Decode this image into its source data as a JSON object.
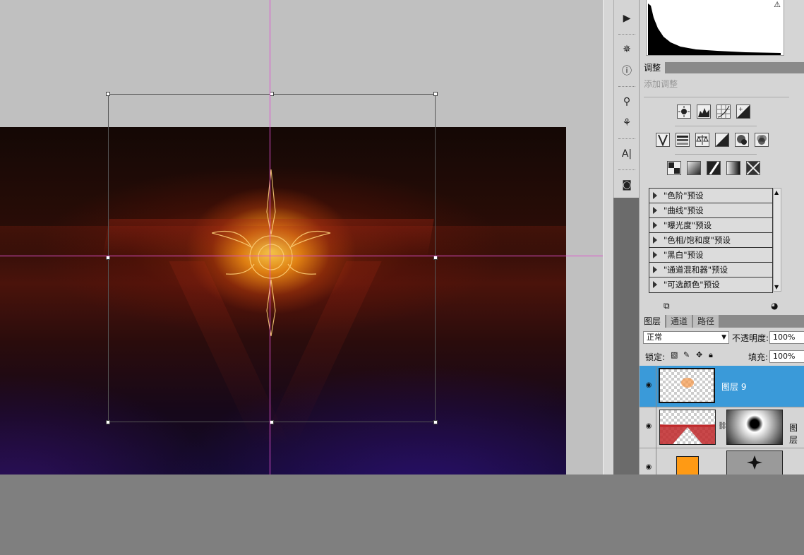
{
  "adjustments": {
    "tab_label": "调整",
    "subtitle": "添加调整",
    "presets": [
      {
        "label": "\"色阶\"预设"
      },
      {
        "label": "\"曲线\"预设"
      },
      {
        "label": "\"曝光度\"预设"
      },
      {
        "label": "\"色相/饱和度\"预设"
      },
      {
        "label": "\"黑白\"预设"
      },
      {
        "label": "\"通道混和器\"预设"
      },
      {
        "label": "\"可选颜色\"预设"
      }
    ]
  },
  "layers": {
    "tabs": [
      "图层",
      "通道",
      "路径"
    ],
    "blend_mode": "正常",
    "opacity_label": "不透明度:",
    "opacity_value": "100%",
    "lock_label": "锁定:",
    "fill_label": "填充:",
    "fill_value": "100%",
    "items": [
      {
        "name": "图层 9",
        "selected": true
      },
      {
        "name": "图层",
        "selected": false
      },
      {
        "name": "",
        "selected": false
      }
    ]
  },
  "icons": {
    "dock": [
      "play-icon",
      "compass-icon",
      "info-icon",
      "brush-presets-icon",
      "clone-source-icon",
      "character-icon",
      "mask-icon"
    ],
    "adjust_row1": [
      "brightness-icon",
      "levels-icon",
      "curves-icon",
      "exposure-icon"
    ],
    "adjust_row2": [
      "vibrance-icon",
      "hue-saturation-icon",
      "color-balance-icon",
      "black-white-icon",
      "photo-filter-icon",
      "channel-mixer-icon"
    ],
    "adjust_row3": [
      "invert-icon",
      "posterize-icon",
      "threshold-icon",
      "gradient-map-icon",
      "selective-color-icon"
    ]
  },
  "colors": {
    "selected_layer": "#3a9ad9",
    "guide": "#e050d0",
    "workspace": "#c0c0c0"
  }
}
